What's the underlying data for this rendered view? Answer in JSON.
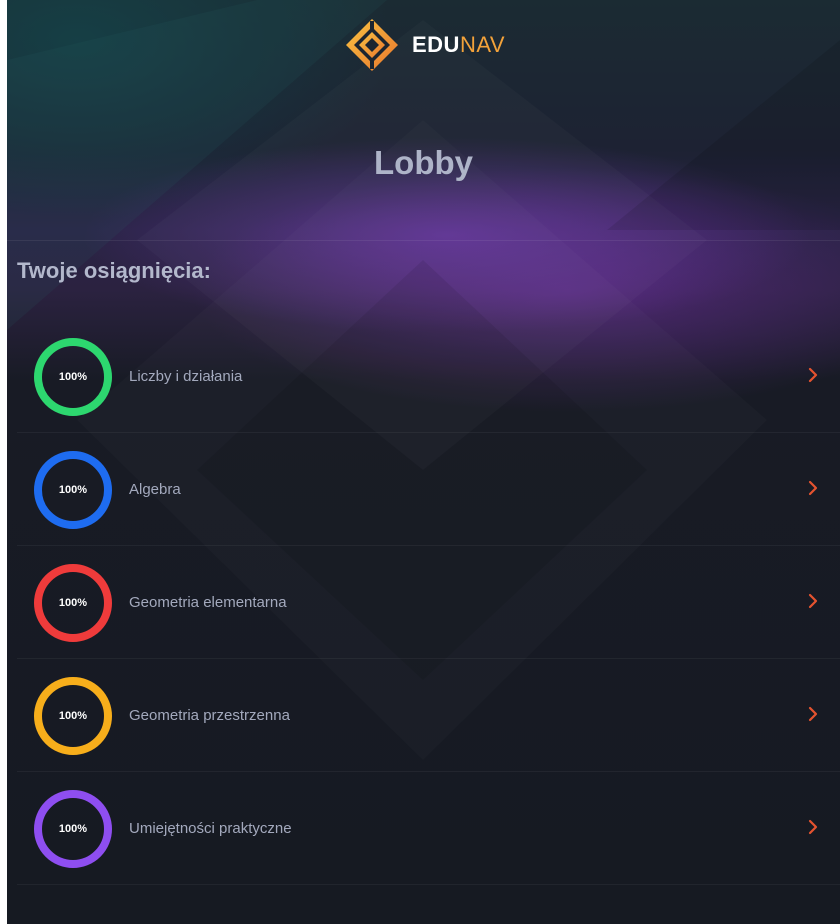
{
  "header": {
    "brand_bold": "EDU",
    "brand_light": "NAV",
    "logo_icon": "edunav-diamond-logo"
  },
  "page": {
    "title": "Lobby"
  },
  "achievements": {
    "heading": "Twoje osiągnięcia:",
    "items": [
      {
        "label": "Liczby i działania",
        "percent": "100%",
        "color": "#2dd76f",
        "chevron_icon": "chevron-right-icon"
      },
      {
        "label": "Algebra",
        "percent": "100%",
        "color": "#1e6cf0",
        "chevron_icon": "chevron-right-icon"
      },
      {
        "label": "Geometria elementarna",
        "percent": "100%",
        "color": "#ef3b3b",
        "chevron_icon": "chevron-right-icon"
      },
      {
        "label": "Geometria przestrzenna",
        "percent": "100%",
        "color": "#f7ae1b",
        "chevron_icon": "chevron-right-icon"
      },
      {
        "label": "Umiejętności praktyczne",
        "percent": "100%",
        "color": "#8e4ef0",
        "chevron_icon": "chevron-right-icon"
      }
    ]
  },
  "colors": {
    "accent_orange": "#f3a23a",
    "chevron": "#e5532f",
    "background": "#161a22"
  }
}
